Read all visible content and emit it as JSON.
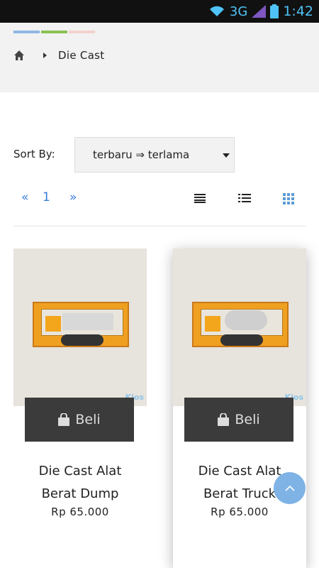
{
  "status_bar": {
    "network": "3G",
    "time": "1:42"
  },
  "header": {
    "color_strip": [
      "#8fb8e6",
      "#8cc153",
      "#f3d2cc"
    ],
    "breadcrumb": {
      "home_icon": "home-icon",
      "current": "Die Cast"
    }
  },
  "sort": {
    "label": "Sort By:",
    "selected": "terbaru ⇒ terlama"
  },
  "pagination": {
    "prev": "«",
    "page": "1",
    "next": "»"
  },
  "view_toggles": [
    "list-lines-icon",
    "list-bullets-icon",
    "grid-icon"
  ],
  "products": [
    {
      "title_line1": "Die Cast Alat",
      "title_line2": "Berat Dump",
      "price": "Rp 65.000",
      "buy_label": "Beli",
      "watermark": "Kios"
    },
    {
      "title_line1": "Die Cast Alat",
      "title_line2": "Berat Truck",
      "price": "Rp 65.000",
      "buy_label": "Beli",
      "watermark": "Kios"
    }
  ],
  "colors": {
    "accent": "#3a7bd5",
    "button_dark": "#3b3b3b",
    "to_top": "#7fb3e6"
  }
}
